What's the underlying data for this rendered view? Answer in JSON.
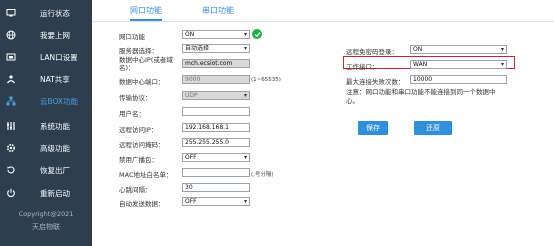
{
  "sidebar": {
    "items": [
      {
        "label": "运行状态",
        "icon": "monitor-icon"
      },
      {
        "label": "我要上网",
        "icon": "globe-icon"
      },
      {
        "label": "LAN口设置",
        "icon": "lan-port-icon"
      },
      {
        "label": "NAT共享",
        "icon": "share-icon"
      },
      {
        "label": "云BOX功能",
        "icon": "cloud-network-icon"
      },
      {
        "label": "系统功能",
        "icon": "wrench-icon"
      },
      {
        "label": "高级功能",
        "icon": "gear-icon"
      },
      {
        "label": "恢复出厂",
        "icon": "restore-icon"
      },
      {
        "label": "重新启动",
        "icon": "power-icon"
      }
    ],
    "active_label": "云BOX功能",
    "copyright": "Copyright@2021",
    "company": "天启物联"
  },
  "tabs": [
    "网口功能",
    "串口功能"
  ],
  "form": {
    "net_func": {
      "label": "网口功能",
      "value": "ON"
    },
    "server_select": {
      "label": "服务器选择：",
      "value": "自动选择"
    },
    "datacenter_ip": {
      "label": "数据中心IP(或者域名)：",
      "value": "mch.ecsiot.com"
    },
    "datacenter_port": {
      "label": "数据中心端口：",
      "value": "9000",
      "hint": "(1~65535)"
    },
    "protocol": {
      "label": "传输协议：",
      "value": "UDP"
    },
    "username": {
      "label": "用户名：",
      "value": ""
    },
    "remote_ip": {
      "label": "远程访问IP：",
      "value": "192.168.168.1"
    },
    "remote_mask": {
      "label": "远程访问掩码：",
      "value": "255.255.255.0"
    },
    "broadcast": {
      "label": "禁用广播包：",
      "value": "OFF"
    },
    "mac_whitelist": {
      "label": "MAC地址白名单：",
      "value": "",
      "hint": "(,号分隔)"
    },
    "heartbeat": {
      "label": "心跳间隔：",
      "value": "30"
    },
    "auto_send": {
      "label": "自动发送数据：",
      "value": "OFF"
    }
  },
  "right": {
    "remote_login": {
      "label": "远程免密码登录：",
      "value": "ON"
    },
    "work_port": {
      "label": "工作接口：",
      "value": "WAN"
    },
    "max_retry": {
      "label": "最大连接失败次数：",
      "value": "10000"
    },
    "note": "注意：网口功能和串口功能不能连接到同一个数据中心。"
  },
  "buttons": {
    "save": "保存",
    "restore": "还原"
  },
  "colors": {
    "sidebar_bg": "#2e3e4e",
    "accent": "#3a8ee6",
    "button": "#2f8fda",
    "highlight": "#d0202c",
    "ok": "#22b04a"
  }
}
